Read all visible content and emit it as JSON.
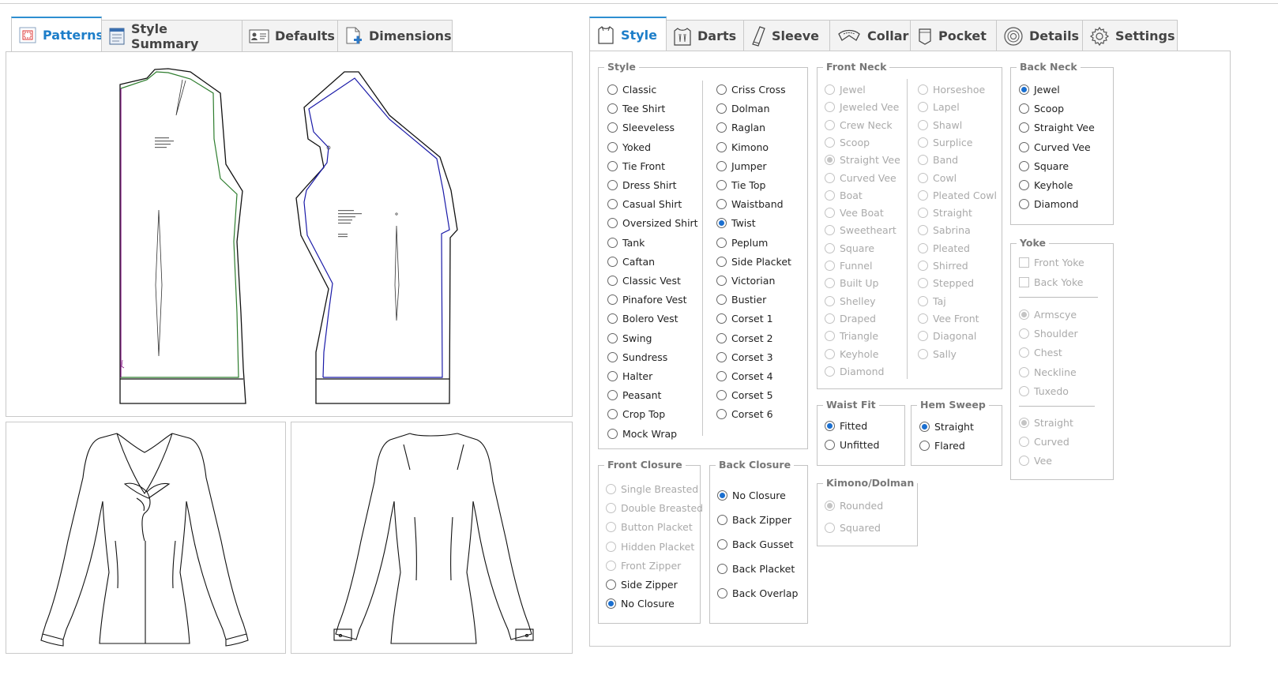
{
  "left_tabs": [
    {
      "label": "Patterns",
      "icon": "patterns-icon",
      "active": true
    },
    {
      "label": "Style Summary",
      "icon": "style-summary-icon",
      "active": false
    },
    {
      "label": "Defaults",
      "icon": "defaults-icon",
      "active": false
    },
    {
      "label": "Dimensions",
      "icon": "dimensions-icon",
      "active": false
    }
  ],
  "right_tabs": [
    {
      "label": "Style",
      "icon": "shirt-icon",
      "active": true
    },
    {
      "label": "Darts",
      "icon": "darts-icon",
      "active": false
    },
    {
      "label": "Sleeve",
      "icon": "sleeve-icon",
      "active": false
    },
    {
      "label": "Collar",
      "icon": "collar-icon",
      "active": false
    },
    {
      "label": "Pocket",
      "icon": "pocket-icon",
      "active": false
    },
    {
      "label": "Details",
      "icon": "details-icon",
      "active": false
    },
    {
      "label": "Settings",
      "icon": "gear-icon",
      "active": false
    }
  ],
  "style_group": {
    "title": "Style",
    "col1": [
      "Classic",
      "Tee Shirt",
      "Sleeveless",
      "Yoked",
      "Tie Front",
      "Dress Shirt",
      "Casual Shirt",
      "Oversized Shirt",
      "Tank",
      "Caftan",
      "Classic Vest",
      "Pinafore Vest",
      "Bolero Vest",
      "Swing",
      "Sundress",
      "Halter",
      "Peasant",
      "Crop Top",
      "Mock Wrap"
    ],
    "col2": [
      "Criss Cross",
      "Dolman",
      "Raglan",
      "Kimono",
      "Jumper",
      "Tie Top",
      "Waistband",
      "Twist",
      "Peplum",
      "Side Placket",
      "Victorian",
      "Bustier",
      "Corset 1",
      "Corset 2",
      "Corset 3",
      "Corset 4",
      "Corset 5",
      "Corset 6"
    ],
    "selected": "Twist"
  },
  "front_neck": {
    "title": "Front Neck",
    "col1": [
      "Jewel",
      "Jeweled Vee",
      "Crew Neck",
      "Scoop",
      "Straight Vee",
      "Curved Vee",
      "Boat",
      "Vee Boat",
      "Sweetheart",
      "Square",
      "Funnel",
      "Built Up",
      "Shelley",
      "Draped",
      "Triangle",
      "Keyhole",
      "Diamond"
    ],
    "col2": [
      "Horseshoe",
      "Lapel",
      "Shawl",
      "Surplice",
      "Band",
      "Cowl",
      "Pleated Cowl",
      "Straight",
      "Sabrina",
      "Pleated",
      "Shirred",
      "Stepped",
      "Taj",
      "Vee Front",
      "Diagonal",
      "Sally"
    ],
    "selected": "Straight Vee"
  },
  "back_neck": {
    "title": "Back Neck",
    "options": [
      "Jewel",
      "Scoop",
      "Straight Vee",
      "Curved Vee",
      "Square",
      "Keyhole",
      "Diamond"
    ],
    "selected": "Jewel"
  },
  "yoke": {
    "title": "Yoke",
    "checks": [
      "Front Yoke",
      "Back Yoke"
    ],
    "position": [
      "Armscye",
      "Shoulder",
      "Chest",
      "Neckline",
      "Tuxedo"
    ],
    "position_selected": "Armscye",
    "shape": [
      "Straight",
      "Curved",
      "Vee"
    ],
    "shape_selected": "Straight"
  },
  "waist_fit": {
    "title": "Waist Fit",
    "options": [
      "Fitted",
      "Unfitted"
    ],
    "selected": "Fitted"
  },
  "hem_sweep": {
    "title": "Hem Sweep",
    "options": [
      "Straight",
      "Flared"
    ],
    "selected": "Straight"
  },
  "kimono_dolman": {
    "title": "Kimono/Dolman",
    "options": [
      "Rounded",
      "Squared"
    ],
    "selected": "Rounded"
  },
  "front_closure": {
    "title": "Front Closure",
    "options": [
      "Single Breasted",
      "Double Breasted",
      "Button Placket",
      "Hidden Placket",
      "Front Zipper",
      "Side Zipper",
      "No Closure"
    ],
    "disabled": [
      "Single Breasted",
      "Double Breasted",
      "Button Placket",
      "Hidden Placket",
      "Front Zipper"
    ],
    "selected": "No Closure"
  },
  "back_closure": {
    "title": "Back Closure",
    "options": [
      "No Closure",
      "Back Zipper",
      "Back Gusset",
      "Back Placket",
      "Back Overlap"
    ],
    "selected": "No Closure"
  },
  "colors": {
    "accent": "#1d7ec9",
    "front_pattern_line": "#2e7d2e",
    "back_pattern_line": "#1a1aa8"
  }
}
